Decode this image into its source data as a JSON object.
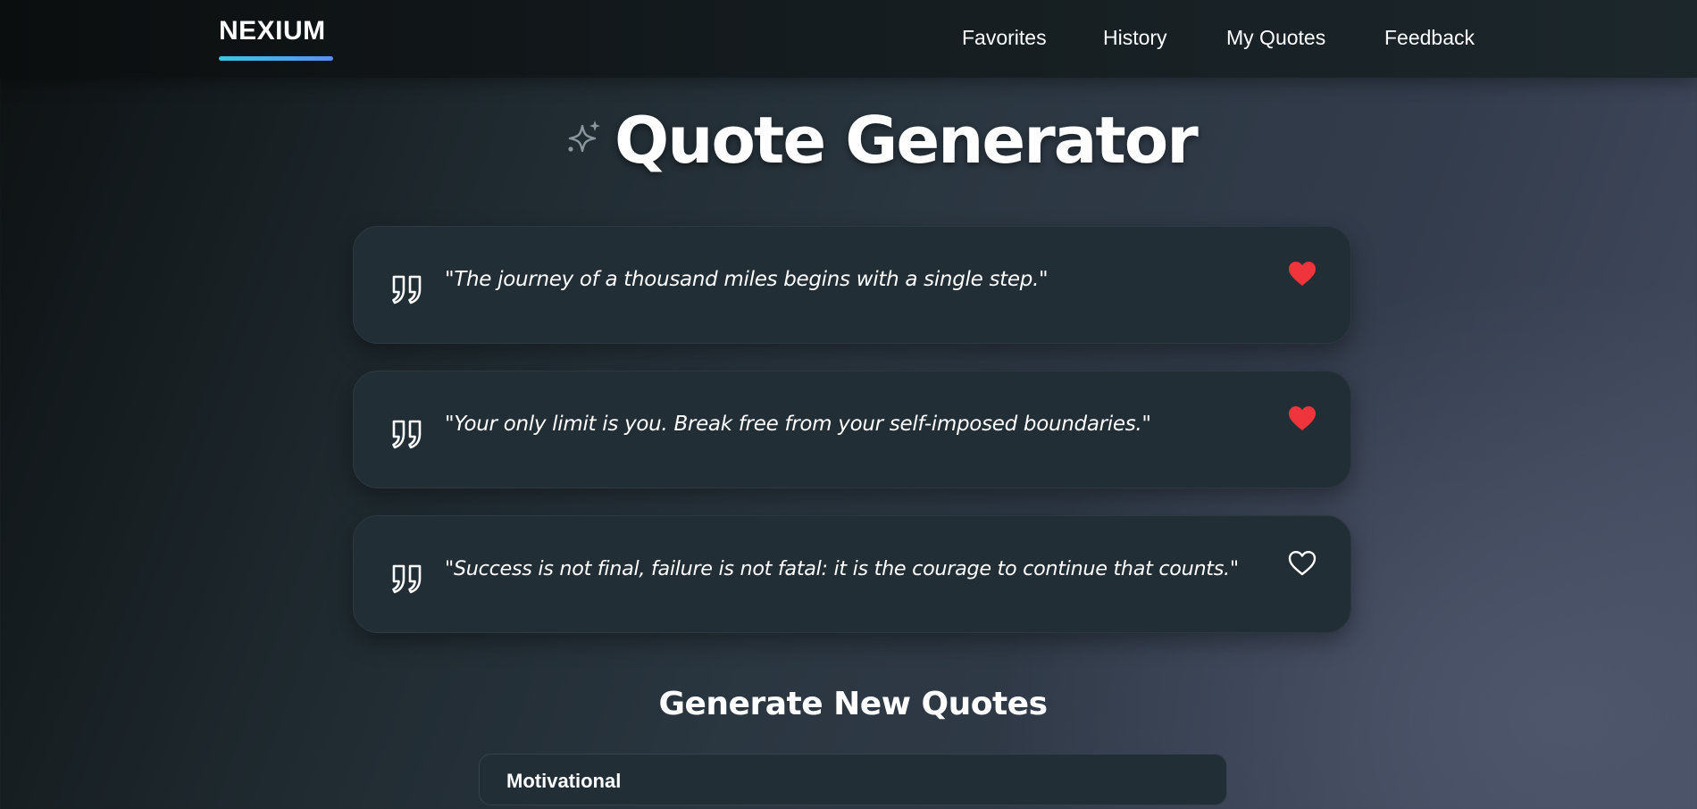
{
  "navbar": {
    "logo": "NEXIUM",
    "links": [
      {
        "label": "Favorites"
      },
      {
        "label": "History"
      },
      {
        "label": "My Quotes"
      },
      {
        "label": "Feedback"
      }
    ]
  },
  "header": {
    "icon": "sparkle-icon",
    "title": "Quote Generator"
  },
  "quotes": [
    {
      "text": "\"The journey of a thousand miles begins with a single step.\"",
      "favorited": true
    },
    {
      "text": "\"Your only limit is you. Break free from your self-imposed boundaries.\"",
      "favorited": true
    },
    {
      "text": "\"Success is not final, failure is not fatal: it is the courage to continue that counts.\"",
      "favorited": false
    }
  ],
  "generator": {
    "title": "Generate New Quotes",
    "category_selected": "Motivational"
  },
  "colors": {
    "accent_start": "#38c9e0",
    "accent_end": "#5b8df5",
    "heart_active": "#f0343c",
    "card_bg": "#222e35"
  }
}
